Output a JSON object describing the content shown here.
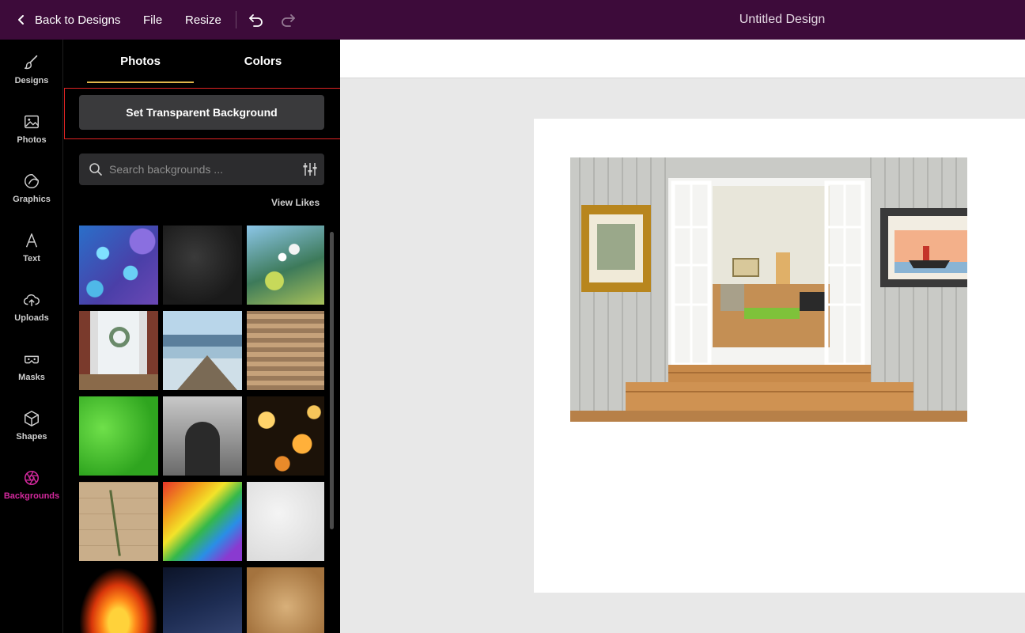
{
  "topbar": {
    "back_label": "Back to Designs",
    "file_label": "File",
    "resize_label": "Resize",
    "title": "Untitled Design"
  },
  "rail": {
    "items": [
      {
        "label": "Designs",
        "icon": "brush-icon"
      },
      {
        "label": "Photos",
        "icon": "image-icon"
      },
      {
        "label": "Graphics",
        "icon": "sticker-icon"
      },
      {
        "label": "Text",
        "icon": "text-icon"
      },
      {
        "label": "Uploads",
        "icon": "cloud-upload-icon"
      },
      {
        "label": "Masks",
        "icon": "mask-icon"
      },
      {
        "label": "Shapes",
        "icon": "cube-icon"
      },
      {
        "label": "Backgrounds",
        "icon": "aperture-icon",
        "active": true
      }
    ]
  },
  "panel": {
    "tabs": [
      {
        "label": "Photos",
        "active": true
      },
      {
        "label": "Colors",
        "active": false
      }
    ],
    "transparent_button": "Set Transparent Background",
    "search": {
      "placeholder": "Search backgrounds ...",
      "value": ""
    },
    "view_likes": "View Likes",
    "thumbnails": [
      "blue-bokeh",
      "dark-stone",
      "cherry-blossom",
      "wreath-door",
      "lake-dock",
      "brick-wall",
      "green-grass",
      "stone-arch",
      "golden-bokeh",
      "white-flowers-wood",
      "rainbow-glitter",
      "white-texture",
      "fire",
      "night-sky",
      "old-paper"
    ]
  },
  "colors": {
    "topbar": "#3d0b3a",
    "active_accent": "#d3299d",
    "tab_underline": "#e0b64a",
    "highlight": "#e02424"
  }
}
